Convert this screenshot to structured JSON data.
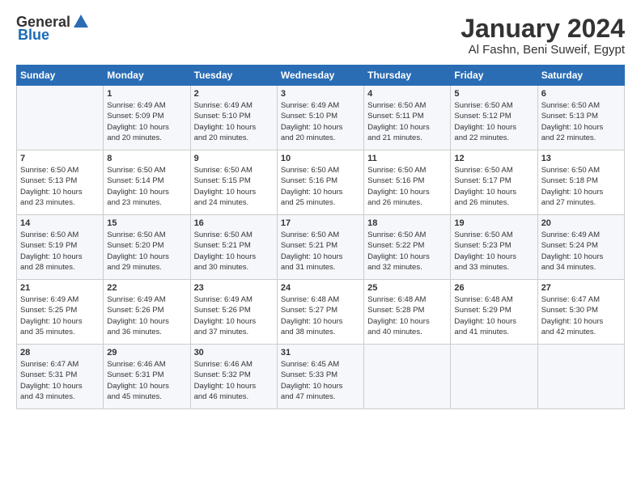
{
  "header": {
    "logo_general": "General",
    "logo_blue": "Blue",
    "month_title": "January 2024",
    "location": "Al Fashn, Beni Suweif, Egypt"
  },
  "columns": [
    "Sunday",
    "Monday",
    "Tuesday",
    "Wednesday",
    "Thursday",
    "Friday",
    "Saturday"
  ],
  "weeks": [
    [
      {
        "day": "",
        "sunrise": "",
        "sunset": "",
        "daylight": ""
      },
      {
        "day": "1",
        "sunrise": "Sunrise: 6:49 AM",
        "sunset": "Sunset: 5:09 PM",
        "daylight": "Daylight: 10 hours and 20 minutes."
      },
      {
        "day": "2",
        "sunrise": "Sunrise: 6:49 AM",
        "sunset": "Sunset: 5:10 PM",
        "daylight": "Daylight: 10 hours and 20 minutes."
      },
      {
        "day": "3",
        "sunrise": "Sunrise: 6:49 AM",
        "sunset": "Sunset: 5:10 PM",
        "daylight": "Daylight: 10 hours and 20 minutes."
      },
      {
        "day": "4",
        "sunrise": "Sunrise: 6:50 AM",
        "sunset": "Sunset: 5:11 PM",
        "daylight": "Daylight: 10 hours and 21 minutes."
      },
      {
        "day": "5",
        "sunrise": "Sunrise: 6:50 AM",
        "sunset": "Sunset: 5:12 PM",
        "daylight": "Daylight: 10 hours and 22 minutes."
      },
      {
        "day": "6",
        "sunrise": "Sunrise: 6:50 AM",
        "sunset": "Sunset: 5:13 PM",
        "daylight": "Daylight: 10 hours and 22 minutes."
      }
    ],
    [
      {
        "day": "7",
        "sunrise": "Sunrise: 6:50 AM",
        "sunset": "Sunset: 5:13 PM",
        "daylight": "Daylight: 10 hours and 23 minutes."
      },
      {
        "day": "8",
        "sunrise": "Sunrise: 6:50 AM",
        "sunset": "Sunset: 5:14 PM",
        "daylight": "Daylight: 10 hours and 23 minutes."
      },
      {
        "day": "9",
        "sunrise": "Sunrise: 6:50 AM",
        "sunset": "Sunset: 5:15 PM",
        "daylight": "Daylight: 10 hours and 24 minutes."
      },
      {
        "day": "10",
        "sunrise": "Sunrise: 6:50 AM",
        "sunset": "Sunset: 5:16 PM",
        "daylight": "Daylight: 10 hours and 25 minutes."
      },
      {
        "day": "11",
        "sunrise": "Sunrise: 6:50 AM",
        "sunset": "Sunset: 5:16 PM",
        "daylight": "Daylight: 10 hours and 26 minutes."
      },
      {
        "day": "12",
        "sunrise": "Sunrise: 6:50 AM",
        "sunset": "Sunset: 5:17 PM",
        "daylight": "Daylight: 10 hours and 26 minutes."
      },
      {
        "day": "13",
        "sunrise": "Sunrise: 6:50 AM",
        "sunset": "Sunset: 5:18 PM",
        "daylight": "Daylight: 10 hours and 27 minutes."
      }
    ],
    [
      {
        "day": "14",
        "sunrise": "Sunrise: 6:50 AM",
        "sunset": "Sunset: 5:19 PM",
        "daylight": "Daylight: 10 hours and 28 minutes."
      },
      {
        "day": "15",
        "sunrise": "Sunrise: 6:50 AM",
        "sunset": "Sunset: 5:20 PM",
        "daylight": "Daylight: 10 hours and 29 minutes."
      },
      {
        "day": "16",
        "sunrise": "Sunrise: 6:50 AM",
        "sunset": "Sunset: 5:21 PM",
        "daylight": "Daylight: 10 hours and 30 minutes."
      },
      {
        "day": "17",
        "sunrise": "Sunrise: 6:50 AM",
        "sunset": "Sunset: 5:21 PM",
        "daylight": "Daylight: 10 hours and 31 minutes."
      },
      {
        "day": "18",
        "sunrise": "Sunrise: 6:50 AM",
        "sunset": "Sunset: 5:22 PM",
        "daylight": "Daylight: 10 hours and 32 minutes."
      },
      {
        "day": "19",
        "sunrise": "Sunrise: 6:50 AM",
        "sunset": "Sunset: 5:23 PM",
        "daylight": "Daylight: 10 hours and 33 minutes."
      },
      {
        "day": "20",
        "sunrise": "Sunrise: 6:49 AM",
        "sunset": "Sunset: 5:24 PM",
        "daylight": "Daylight: 10 hours and 34 minutes."
      }
    ],
    [
      {
        "day": "21",
        "sunrise": "Sunrise: 6:49 AM",
        "sunset": "Sunset: 5:25 PM",
        "daylight": "Daylight: 10 hours and 35 minutes."
      },
      {
        "day": "22",
        "sunrise": "Sunrise: 6:49 AM",
        "sunset": "Sunset: 5:26 PM",
        "daylight": "Daylight: 10 hours and 36 minutes."
      },
      {
        "day": "23",
        "sunrise": "Sunrise: 6:49 AM",
        "sunset": "Sunset: 5:26 PM",
        "daylight": "Daylight: 10 hours and 37 minutes."
      },
      {
        "day": "24",
        "sunrise": "Sunrise: 6:48 AM",
        "sunset": "Sunset: 5:27 PM",
        "daylight": "Daylight: 10 hours and 38 minutes."
      },
      {
        "day": "25",
        "sunrise": "Sunrise: 6:48 AM",
        "sunset": "Sunset: 5:28 PM",
        "daylight": "Daylight: 10 hours and 40 minutes."
      },
      {
        "day": "26",
        "sunrise": "Sunrise: 6:48 AM",
        "sunset": "Sunset: 5:29 PM",
        "daylight": "Daylight: 10 hours and 41 minutes."
      },
      {
        "day": "27",
        "sunrise": "Sunrise: 6:47 AM",
        "sunset": "Sunset: 5:30 PM",
        "daylight": "Daylight: 10 hours and 42 minutes."
      }
    ],
    [
      {
        "day": "28",
        "sunrise": "Sunrise: 6:47 AM",
        "sunset": "Sunset: 5:31 PM",
        "daylight": "Daylight: 10 hours and 43 minutes."
      },
      {
        "day": "29",
        "sunrise": "Sunrise: 6:46 AM",
        "sunset": "Sunset: 5:31 PM",
        "daylight": "Daylight: 10 hours and 45 minutes."
      },
      {
        "day": "30",
        "sunrise": "Sunrise: 6:46 AM",
        "sunset": "Sunset: 5:32 PM",
        "daylight": "Daylight: 10 hours and 46 minutes."
      },
      {
        "day": "31",
        "sunrise": "Sunrise: 6:45 AM",
        "sunset": "Sunset: 5:33 PM",
        "daylight": "Daylight: 10 hours and 47 minutes."
      },
      {
        "day": "",
        "sunrise": "",
        "sunset": "",
        "daylight": ""
      },
      {
        "day": "",
        "sunrise": "",
        "sunset": "",
        "daylight": ""
      },
      {
        "day": "",
        "sunrise": "",
        "sunset": "",
        "daylight": ""
      }
    ]
  ]
}
